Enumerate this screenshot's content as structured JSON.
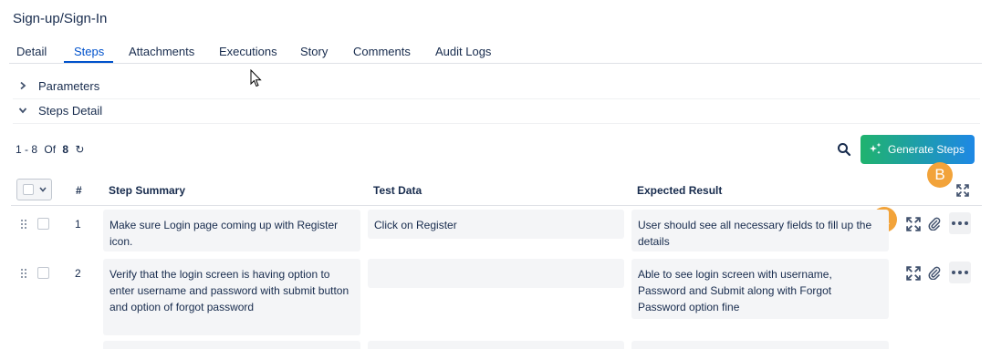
{
  "page": {
    "title": "Sign-up/Sign-In"
  },
  "tabs": [
    {
      "label": "Detail",
      "active": false
    },
    {
      "label": "Steps",
      "active": true
    },
    {
      "label": "Attachments",
      "active": false
    },
    {
      "label": "Executions",
      "active": false
    },
    {
      "label": "Story",
      "active": false
    },
    {
      "label": "Comments",
      "active": false
    },
    {
      "label": "Audit Logs",
      "active": false
    }
  ],
  "sections": {
    "parameters": {
      "label": "Parameters",
      "expanded": false,
      "icon": "chevron-right-icon"
    },
    "steps_detail": {
      "label": "Steps Detail",
      "expanded": true,
      "icon": "chevron-down-icon"
    }
  },
  "toolbar": {
    "range": "1 - 8",
    "of_label": "Of",
    "total": "8",
    "refresh_icon": "refresh-icon",
    "search_icon": "search-icon",
    "generate_label": "Generate Steps",
    "generate_icon": "sparkle-icon"
  },
  "badges": {
    "a": "A",
    "b": "B",
    "color": "#f2a33a"
  },
  "table": {
    "columns": {
      "num": "#",
      "summary": "Step Summary",
      "test_data": "Test Data",
      "expected": "Expected Result"
    },
    "rows": [
      {
        "num": "1",
        "summary": "Make sure Login page coming up with Register icon.",
        "test_data": "Click on Register",
        "expected": "User should see all necessary fields to fill up the details"
      },
      {
        "num": "2",
        "summary": "Verify that the login screen is having option to enter username and password with submit button and option of forgot password",
        "test_data": "",
        "expected": "Able to see login screen with username, Password and Submit along with Forgot Password option fine"
      }
    ]
  },
  "colors": {
    "accent": "#0052cc",
    "gradient_start": "#1fb36e",
    "gradient_end": "#1e88e5",
    "cell_bg": "#f4f5f7"
  }
}
